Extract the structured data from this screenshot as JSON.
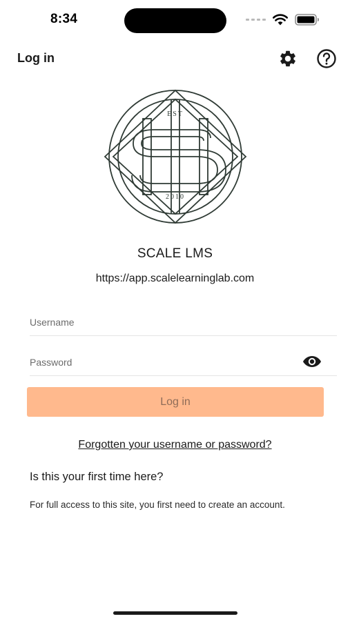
{
  "status_bar": {
    "time": "8:34",
    "icons": [
      "signal-dots-icon",
      "wifi-icon",
      "battery-icon"
    ]
  },
  "header": {
    "title": "Log in",
    "settings_icon": "gear-icon",
    "help_icon": "question-circle-icon"
  },
  "logo": {
    "top_text": "EST",
    "bottom_text": "2010",
    "line_color": "#2f3b35"
  },
  "site": {
    "name": "SCALE LMS",
    "url": "https://app.scalelearninglab.com"
  },
  "form": {
    "username_placeholder": "Username",
    "password_placeholder": "Password",
    "password_toggle_icon": "eye-icon",
    "login_label": "Log in",
    "login_button_color": "#ffb98d"
  },
  "links": {
    "forgot": "Forgotten your username or password?"
  },
  "first_time": {
    "heading": "Is this your first time here?",
    "text": "For full access to this site, you first need to create an account."
  }
}
